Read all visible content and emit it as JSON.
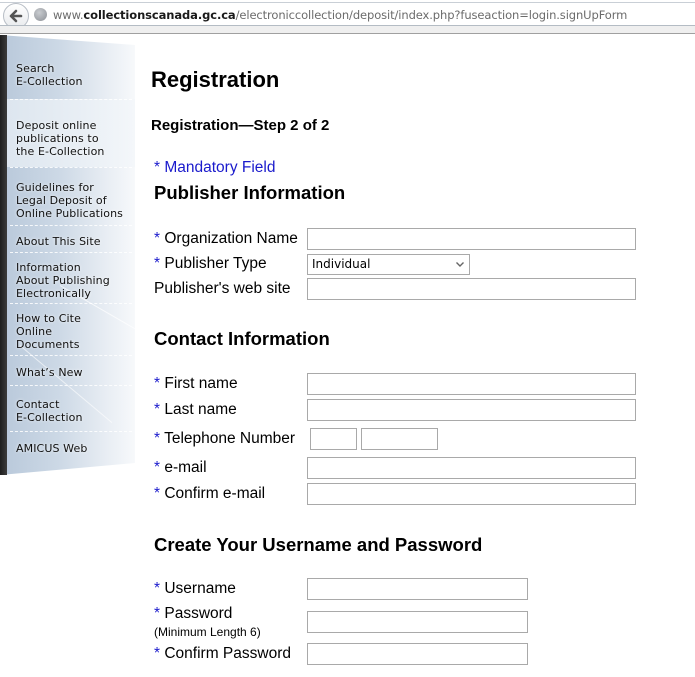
{
  "browser": {
    "url_prefix": "www.",
    "url_domain": "collectionscanada.gc.ca",
    "url_path": "/electroniccollection/deposit/index.php?fuseaction=login.signUpForm"
  },
  "sidebar": {
    "items": [
      {
        "label_lines": [
          "Search",
          "E-Collection"
        ]
      },
      {
        "label_lines": [
          "Deposit online",
          "publications to",
          "the E-Collection"
        ],
        "active": true
      },
      {
        "label_lines": [
          "Guidelines for",
          "Legal Deposit of",
          "Online Publications"
        ]
      },
      {
        "label_lines": [
          "About This Site"
        ]
      },
      {
        "label_lines": [
          "Information",
          "About Publishing",
          "Electronically"
        ]
      },
      {
        "label_lines": [
          "How to Cite",
          "Online",
          "Documents"
        ]
      },
      {
        "label_lines": [
          "What’s New"
        ]
      },
      {
        "label_lines": [
          "Contact",
          "E-Collection"
        ]
      },
      {
        "label_lines": [
          "AMICUS Web"
        ]
      }
    ]
  },
  "page": {
    "title": "Registration",
    "step": "Registration—Step 2 of 2",
    "mandatory_note": "* Mandatory Field",
    "required_marker": "*"
  },
  "publisher": {
    "heading": "Publisher Information",
    "organization_name": {
      "label": "Organization Name",
      "required": true,
      "value": ""
    },
    "publisher_type": {
      "label": "Publisher Type",
      "required": true,
      "selected": "Individual"
    },
    "web_site": {
      "label": "Publisher's web site",
      "required": false,
      "value": ""
    }
  },
  "contact": {
    "heading": "Contact Information",
    "first_name": {
      "label": "First name",
      "value": ""
    },
    "last_name": {
      "label": "Last name",
      "value": ""
    },
    "telephone": {
      "label": "Telephone Number",
      "area_code": "",
      "number": ""
    },
    "email": {
      "label": "e-mail",
      "value": ""
    },
    "confirm_email": {
      "label": "Confirm e-mail",
      "value": ""
    }
  },
  "account": {
    "heading": "Create Your Username and Password",
    "username": {
      "label": "Username",
      "value": ""
    },
    "password": {
      "label": "Password",
      "note": "(Minimum Length 6)",
      "value": ""
    },
    "confirm_password": {
      "label": "Confirm Password",
      "value": ""
    }
  },
  "colors": {
    "required_star": "#1a1acc",
    "link_blue": "#1a1acc",
    "input_border": "#a9a9a9"
  }
}
